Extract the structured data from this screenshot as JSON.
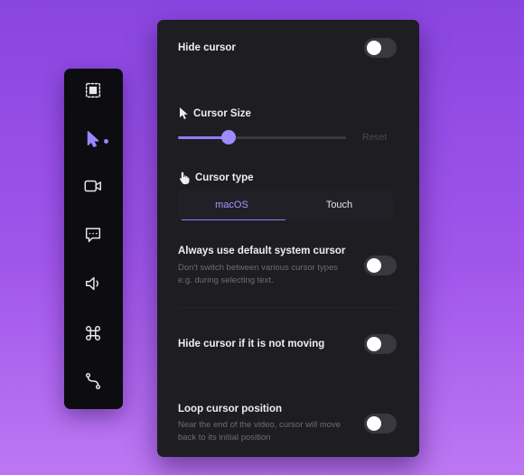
{
  "toolbar": {
    "items": [
      {
        "icon": "selection-icon"
      },
      {
        "icon": "cursor-icon",
        "active": true
      },
      {
        "icon": "video-camera-icon"
      },
      {
        "icon": "chat-icon"
      },
      {
        "icon": "speaker-icon"
      },
      {
        "icon": "command-icon"
      },
      {
        "icon": "path-icon"
      }
    ],
    "accent_color": "#9a86ff"
  },
  "settings": {
    "hide_cursor": {
      "label": "Hide cursor",
      "enabled": false
    },
    "cursor_size": {
      "label": "Cursor Size",
      "value_fraction": 0.3,
      "reset_label": "Reset"
    },
    "cursor_type": {
      "label": "Cursor type",
      "options": [
        "macOS",
        "Touch"
      ],
      "selected": "macOS"
    },
    "default_system_cursor": {
      "label": "Always use default system cursor",
      "description": "Don't switch between various cursor types e.g. during selecting text.",
      "enabled": false
    },
    "hide_when_idle": {
      "label": "Hide cursor if it is not moving",
      "enabled": false
    },
    "loop_position": {
      "label": "Loop cursor position",
      "description": "Near the end of the video, cursor will move back to its initial position",
      "enabled": false
    }
  }
}
